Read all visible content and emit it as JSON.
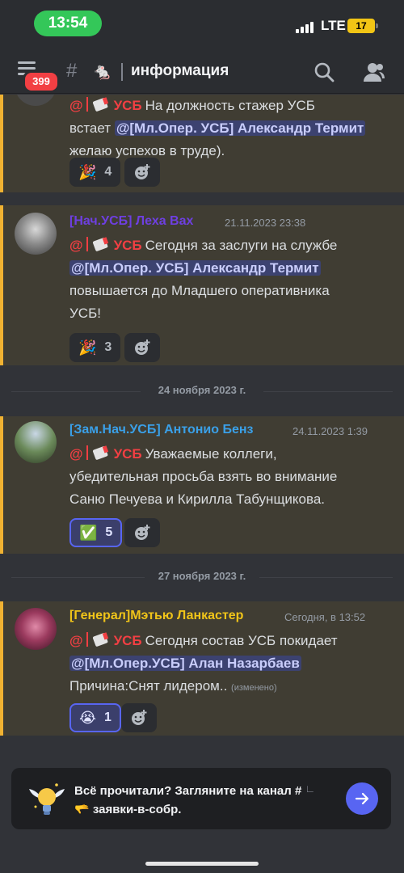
{
  "status": {
    "time": "13:54",
    "network": "LTE",
    "battery": "17"
  },
  "header": {
    "badge_count": "399",
    "channel_emoji": "🐁",
    "channel_name": "информация"
  },
  "role_tag": {
    "at": "@",
    "name": "УСБ"
  },
  "messages": [
    {
      "partial": true,
      "line1_pre": "На должность стажер УСБ",
      "line2_pre": "встает",
      "mention": "@[Мл.Опер. УСБ] Александр Термит",
      "line3": "желаю успехов в труде).",
      "reaction": {
        "emoji": "🎉",
        "count": "4"
      }
    },
    {
      "author": "[Нач.УСБ] Леха Вах",
      "author_color": "#6e3fe0",
      "timestamp": "21.11.2023 23:38",
      "text1": "Сегодня за заслуги на службе",
      "mention": "@[Мл.Опер. УСБ] Александр Термит",
      "text2": "повышается до Младшего оперативника",
      "text3": "УСБ!",
      "reaction": {
        "emoji": "🎉",
        "count": "3"
      }
    },
    {
      "date_divider": "24 ноября 2023 г.",
      "author": "[Зам.Нач.УСБ] Антонио Бенз",
      "author_color": "#3aa0e8",
      "timestamp": "24.11.2023 1:39",
      "text1": "Уважаемые коллеги,",
      "text2": "убедительная просьба взять во внимание",
      "text3": "Саню Печуева и Кирилла Табунщикова.",
      "reaction": {
        "emoji": "✅",
        "count": "5"
      }
    },
    {
      "date_divider": "27 ноября 2023 г.",
      "author": "[Генерал]Мэтью Ланкастер",
      "author_color": "#f0c419",
      "timestamp": "Сегодня, в 13:52",
      "text1": "Сегодня состав УСБ покидает",
      "mention": "@[Мл.Опер.УСБ] Алан Назарбаев",
      "text2": "Причина:Снят лидером..",
      "edited": "(изменено)",
      "reaction": {
        "emoji": "😭",
        "count": "1"
      }
    }
  ],
  "notice": {
    "text": "Всё прочитали? Загляните на канал #",
    "channel_emoji": "🫳",
    "channel_name": "заявки-в-собр."
  }
}
